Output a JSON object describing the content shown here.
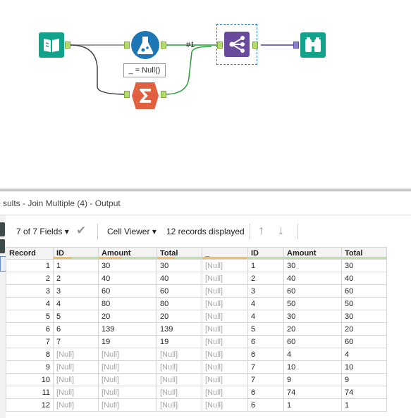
{
  "canvas": {
    "formula_label": "_ = Null()",
    "connection_label": "#1"
  },
  "results": {
    "title": "sults - Join Multiple (4) - Output",
    "toolbar": {
      "fields_label": "7 of 7 Fields",
      "cell_viewer_label": "Cell Viewer",
      "records_label": "12 records displayed"
    },
    "columns": [
      "Record",
      "ID",
      "Amount",
      "Total",
      "_",
      "ID",
      "Amount",
      "Total"
    ],
    "rows": [
      [
        "1",
        "1",
        "30",
        "30",
        "[Null]",
        "1",
        "30",
        "30"
      ],
      [
        "2",
        "2",
        "40",
        "40",
        "[Null]",
        "2",
        "40",
        "40"
      ],
      [
        "3",
        "3",
        "60",
        "60",
        "[Null]",
        "3",
        "60",
        "60"
      ],
      [
        "4",
        "4",
        "80",
        "80",
        "[Null]",
        "4",
        "50",
        "50"
      ],
      [
        "5",
        "5",
        "20",
        "20",
        "[Null]",
        "4",
        "30",
        "30"
      ],
      [
        "6",
        "6",
        "139",
        "139",
        "[Null]",
        "5",
        "20",
        "20"
      ],
      [
        "7",
        "7",
        "19",
        "19",
        "[Null]",
        "6",
        "60",
        "60"
      ],
      [
        "8",
        "[Null]",
        "[Null]",
        "[Null]",
        "[Null]",
        "6",
        "4",
        "4"
      ],
      [
        "9",
        "[Null]",
        "[Null]",
        "[Null]",
        "[Null]",
        "7",
        "10",
        "10"
      ],
      [
        "10",
        "[Null]",
        "[Null]",
        "[Null]",
        "[Null]",
        "7",
        "9",
        "9"
      ],
      [
        "11",
        "[Null]",
        "[Null]",
        "[Null]",
        "[Null]",
        "6",
        "74",
        "74"
      ],
      [
        "12",
        "[Null]",
        "[Null]",
        "[Null]",
        "[Null]",
        "6",
        "1",
        "1"
      ]
    ]
  },
  "colors": {
    "input_tool": "#12a38c",
    "formula_tool": "#1e77b4",
    "summarize_tool": "#e0603f",
    "join_tool": "#6a4a9c",
    "browse_tool": "#12a38c",
    "connection_green": "#2a9c3a",
    "connection_purple": "#4a3fa0"
  }
}
